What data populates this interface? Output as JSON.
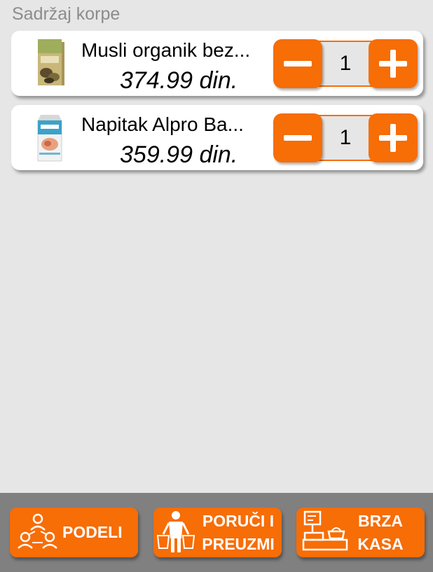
{
  "header": {
    "title": "Sadržaj korpe"
  },
  "cart": {
    "items": [
      {
        "name": "Musli organik bez...",
        "price": "374.99 din.",
        "quantity": "1",
        "image_icon": "muesli-box-icon"
      },
      {
        "name": "Napitak Alpro Ba...",
        "price": "359.99 din.",
        "quantity": "1",
        "image_icon": "alpro-almond-carton-icon"
      }
    ]
  },
  "actions": {
    "share_label": "PODELI",
    "order_label_line1": "PORUČI I",
    "order_label_line2": "PREUZMI",
    "fast_checkout_line1": "BRZA",
    "fast_checkout_line2": "KASA"
  },
  "colors": {
    "accent": "#f76d06",
    "background": "#e6e6e6",
    "bottom_bar": "#808080"
  }
}
